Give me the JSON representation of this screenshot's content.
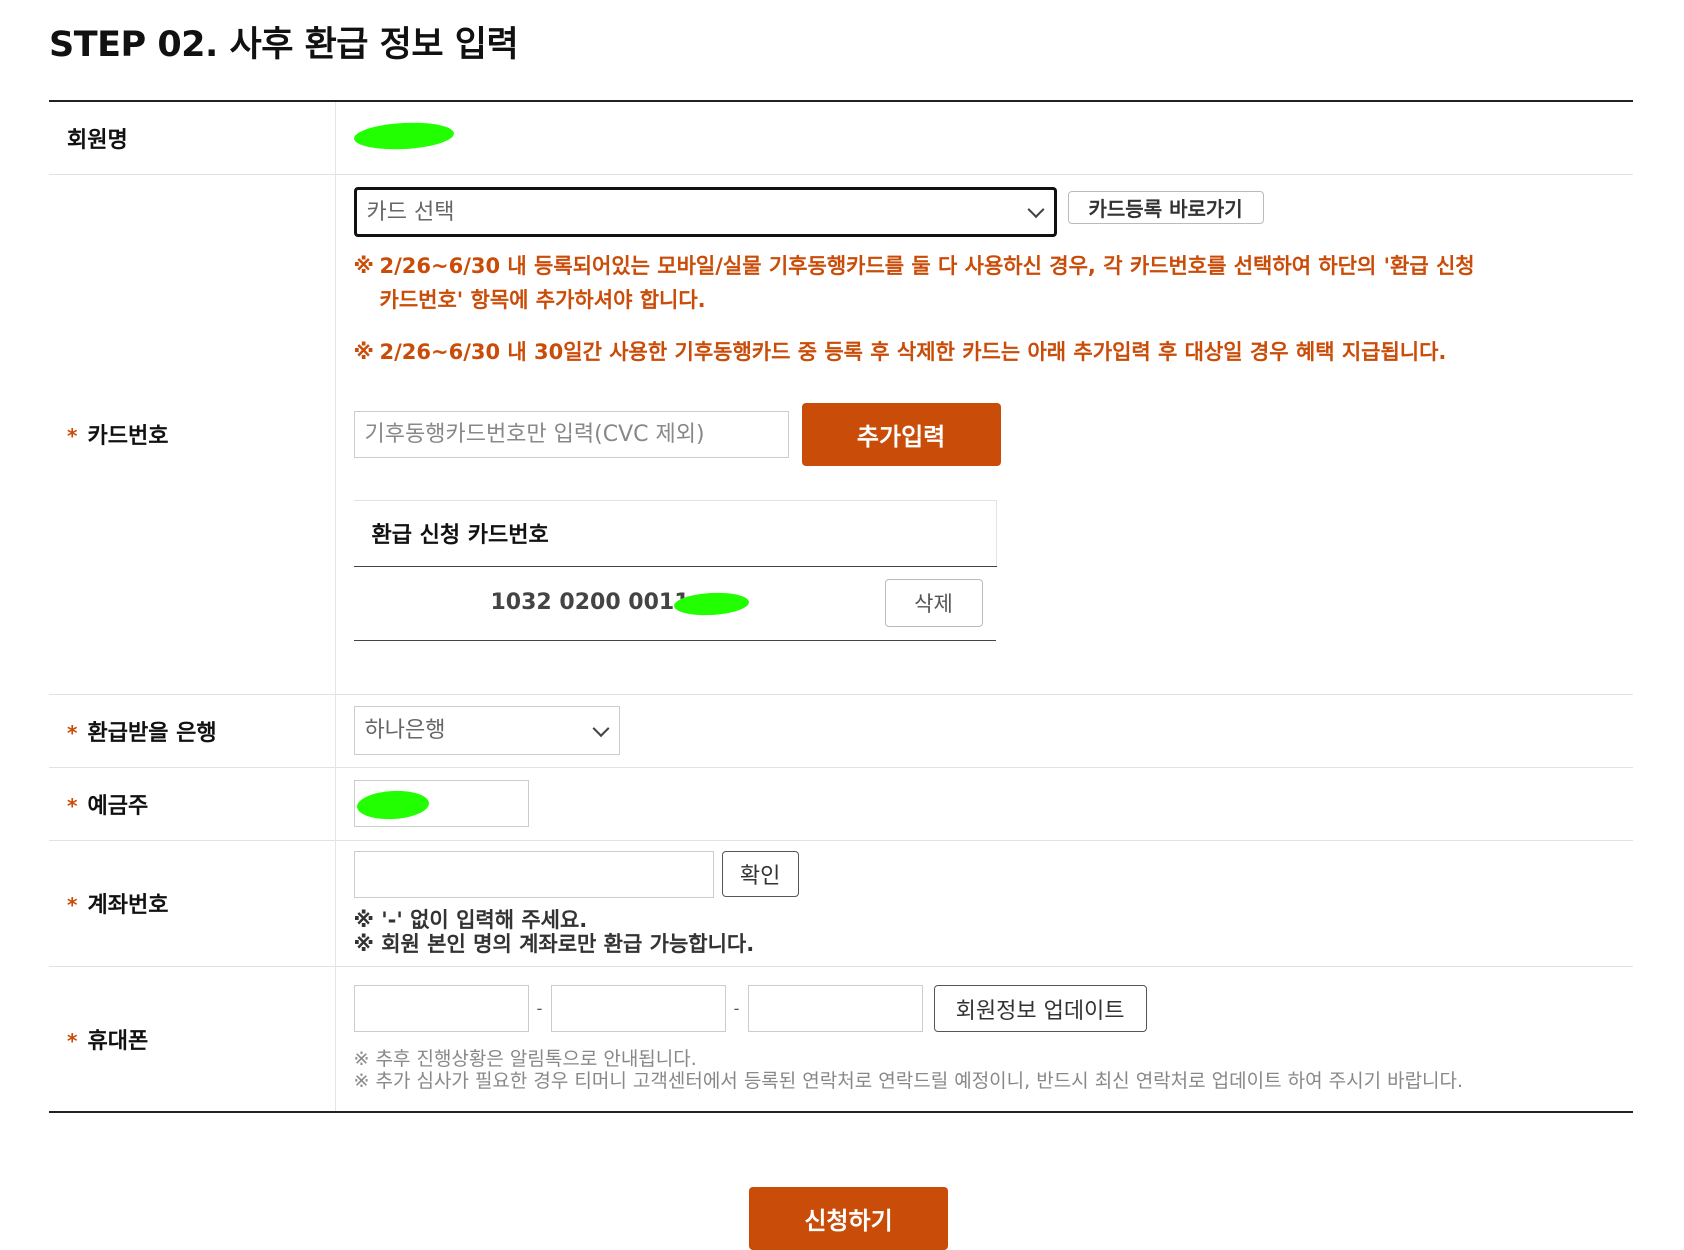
{
  "page": {
    "title": "STEP 02. 사후 환급 정보 입력"
  },
  "form": {
    "member": {
      "label": "회원명"
    },
    "card": {
      "label": "카드번호",
      "select_placeholder": "카드 선택",
      "register_button": "카드등록 바로가기",
      "notice1_line1": "2/26~6/30 내 등록되어있는 모바일/실물 기후동행카드를 둘 다 사용하신 경우, 각 카드번호를 선택하여 하단의 '환급 신청",
      "notice1_line2": "카드번호' 항목에 추가하셔야 합니다.",
      "notice2": "2/26~6/30 내 30일간 사용한 기후동행카드 중 등록 후 삭제한 카드는 아래 추가입력 후 대상일 경우 혜택 지급됩니다.",
      "notice_mark": "※",
      "input_placeholder": "기후동행카드번호만 입력(CVC 제외)",
      "add_button": "추가입력",
      "refund_table_header": "환급 신청 카드번호",
      "refund_card_number": "1032 0200 0011",
      "delete_button": "삭제"
    },
    "bank": {
      "label": "환급받을 은행",
      "selected": "하나은행"
    },
    "holder": {
      "label": "예금주"
    },
    "account": {
      "label": "계좌번호",
      "confirm_button": "확인",
      "notice1": "※ '-' 없이 입력해 주세요.",
      "notice2": "※ 회원 본인 명의 계좌로만 환급 가능합니다."
    },
    "phone": {
      "label": "휴대폰",
      "separator": "-",
      "update_button": "회원정보 업데이트",
      "notice1": "※ 추후 진행상황은 알림톡으로 안내됩니다.",
      "notice2": "※ 추가 심사가 필요한 경우 티머니 고객센터에서 등록된 연락처로 연락드릴 예정이니, 반드시 최신 연락처로 업데이트 하여 주시기 바랍니다."
    },
    "required_mark": "*"
  },
  "submit": {
    "label": "신청하기"
  },
  "colors": {
    "accent": "#c94c08",
    "redaction": "#22ff00"
  }
}
